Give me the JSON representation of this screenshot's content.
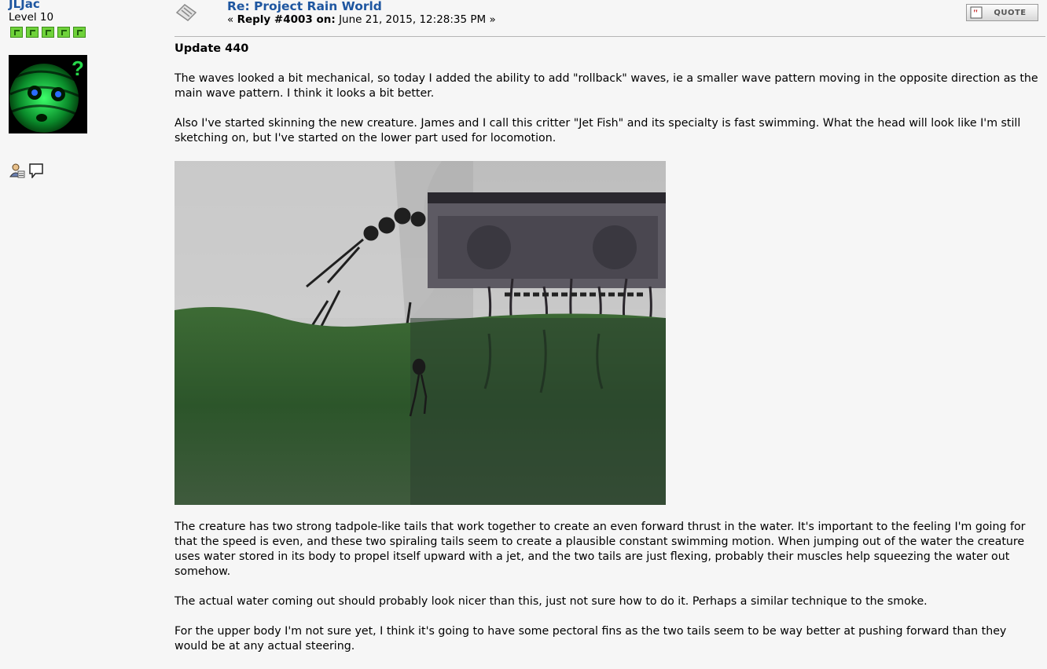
{
  "poster": {
    "username": "JLJac",
    "rank": "Level 10",
    "star_count": 5,
    "icons": [
      "profile-icon",
      "personal-message-icon"
    ]
  },
  "post": {
    "subject": "Re: Project Rain World",
    "reply_prefix": "«",
    "reply_label": "Reply #4003 on:",
    "timestamp": "June 21, 2015, 12:28:35 PM",
    "reply_suffix": "»",
    "quote_label": "QUOTE",
    "title": "Update 440",
    "paragraphs_before_image": [
      "The waves looked a bit mechanical, so today I added the ability to add \"rollback\" waves, ie a smaller wave pattern moving in the opposite direction as the main wave pattern. I think it looks a bit better.",
      "Also I've started skinning the new creature. James and I call this critter \"Jet Fish\" and its specialty is fast swimming. What the head will look like I'm still sketching on, but I've started on the lower part used for locomotion."
    ],
    "paragraphs_after_image": [
      "The creature has two strong tadpole-like tails that work together to create an even forward thrust in the water. It's important to the feeling I'm going for that the speed is even, and these two spiraling tails seem to create a plausible constant swimming motion. When jumping out of the water the creature uses water stored in its body to propel itself upward with a jet, and the two tails are just flexing, probably their muscles help squeezing the water out somehow.",
      "The actual water coming out should probably look nicer than this, just not sure how to do it. Perhaps a similar technique to the smoke.",
      "For the upper body I'm not sure yet, I think it's going to have some pectoral fins as the two tails seem to be way better at pushing forward than they would be at any actual steering."
    ]
  },
  "colors": {
    "link": "#1e56a0",
    "background": "#f6f6f6",
    "star_green": "#6fd23a",
    "water_green": "#2f5d2c"
  }
}
